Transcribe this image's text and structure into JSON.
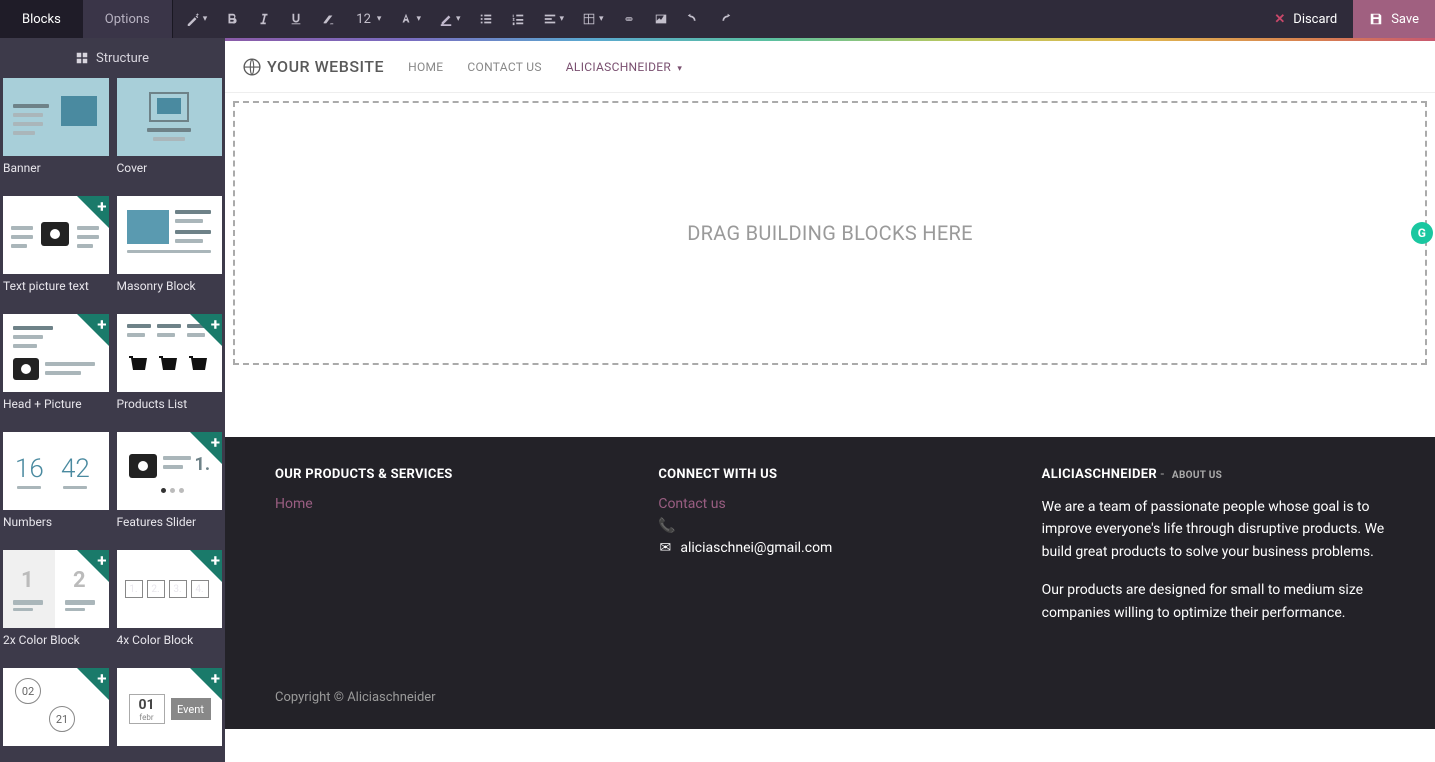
{
  "tabs": {
    "blocks": "Blocks",
    "options": "Options"
  },
  "toolbar": {
    "font_size": "12",
    "discard": "Discard",
    "save": "Save"
  },
  "sidebar": {
    "structure": "Structure",
    "blocks": [
      {
        "label": "Banner",
        "badge": false,
        "teal": true
      },
      {
        "label": "Cover",
        "badge": false,
        "teal": true
      },
      {
        "label": "Text picture text",
        "badge": true,
        "teal": false
      },
      {
        "label": "Masonry Block",
        "badge": false,
        "teal": false
      },
      {
        "label": "Head + Picture",
        "badge": true,
        "teal": false
      },
      {
        "label": "Products List",
        "badge": true,
        "teal": false
      },
      {
        "label": "Numbers",
        "badge": false,
        "teal": false
      },
      {
        "label": "Features Slider",
        "badge": true,
        "teal": false
      },
      {
        "label": "2x Color Block",
        "badge": true,
        "teal": false
      },
      {
        "label": "4x Color Block",
        "badge": true,
        "teal": false
      },
      {
        "label": "",
        "badge": true,
        "teal": false
      },
      {
        "label": "",
        "badge": true,
        "teal": false
      }
    ]
  },
  "site": {
    "logo_text": "YOUR WEBSITE",
    "nav": {
      "home": "HOME",
      "contact": "CONTACT US",
      "user": "ALICIASCHNEIDER"
    },
    "dropzone": "DRAG BUILDING BLOCKS HERE"
  },
  "footer": {
    "col1": {
      "title": "OUR PRODUCTS & SERVICES",
      "home": "Home"
    },
    "col2": {
      "title": "CONNECT WITH US",
      "contact": "Contact us",
      "email": "aliciaschnei@gmail.com"
    },
    "col3": {
      "title": "ALICIASCHNEIDER",
      "about_label": "ABOUT US",
      "para1": "We are a team of passionate people whose goal is to improve everyone's life through disruptive products. We build great products to solve your business problems.",
      "para2": "Our products are designed for small to medium size companies willing to optimize their performance."
    },
    "copyright": "Copyright © Aliciaschneider"
  }
}
